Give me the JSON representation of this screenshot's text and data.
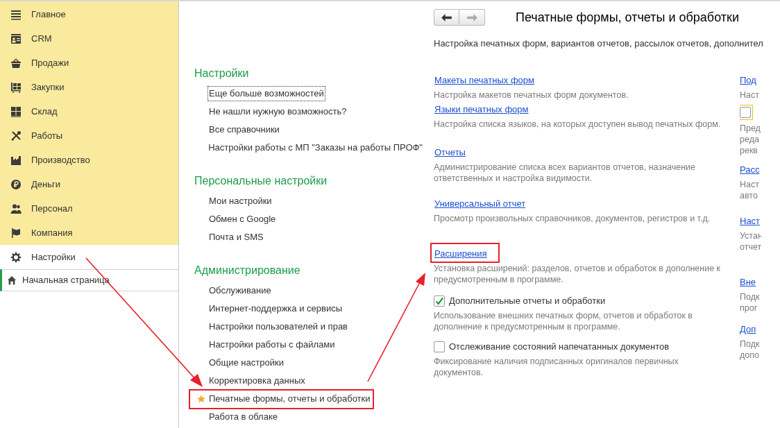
{
  "sidebar": {
    "sections": [
      {
        "label": "Главное",
        "selected": false
      },
      {
        "label": "CRM",
        "selected": false
      },
      {
        "label": "Продажи",
        "selected": false
      },
      {
        "label": "Закупки",
        "selected": false
      },
      {
        "label": "Склад",
        "selected": false
      },
      {
        "label": "Работы",
        "selected": false
      },
      {
        "label": "Производство",
        "selected": false
      },
      {
        "label": "Деньги",
        "selected": false
      },
      {
        "label": "Персонал",
        "selected": false
      },
      {
        "label": "Компания",
        "selected": false
      },
      {
        "label": "Настройки",
        "selected": true
      }
    ],
    "open_tabs": [
      {
        "label": "Начальная страница",
        "selected": true
      }
    ]
  },
  "nav_groups": [
    {
      "title": "Настройки",
      "items": [
        {
          "label": "Еще больше возможностей",
          "focused": true,
          "favorite": false,
          "annotated": false
        },
        {
          "label": "Не нашли нужную возможность?",
          "focused": false,
          "favorite": false,
          "annotated": false
        },
        {
          "label": "Все справочники",
          "focused": false,
          "favorite": false,
          "annotated": false
        },
        {
          "label": "Настройки работы с МП \"Заказы на работы ПРОФ\"",
          "focused": false,
          "favorite": false,
          "annotated": false
        }
      ]
    },
    {
      "title": "Персональные настройки",
      "items": [
        {
          "label": "Мои настройки",
          "focused": false,
          "favorite": false,
          "annotated": false
        },
        {
          "label": "Обмен с Google",
          "focused": false,
          "favorite": false,
          "annotated": false
        },
        {
          "label": "Почта и SMS",
          "focused": false,
          "favorite": false,
          "annotated": false
        }
      ]
    },
    {
      "title": "Администрирование",
      "items": [
        {
          "label": "Обслуживание",
          "focused": false,
          "favorite": false,
          "annotated": false
        },
        {
          "label": "Интернет-поддержка и сервисы",
          "focused": false,
          "favorite": false,
          "annotated": false
        },
        {
          "label": "Настройки пользователей и прав",
          "focused": false,
          "favorite": false,
          "annotated": false
        },
        {
          "label": "Настройки работы с файлами",
          "focused": false,
          "favorite": false,
          "annotated": false
        },
        {
          "label": "Общие настройки",
          "focused": false,
          "favorite": false,
          "annotated": false
        },
        {
          "label": "Корректировка данных",
          "focused": false,
          "favorite": false,
          "annotated": false
        },
        {
          "label": "Печатные формы, отчеты и обработки",
          "focused": false,
          "favorite": true,
          "annotated": true
        },
        {
          "label": "Работа в облаке",
          "focused": false,
          "favorite": false,
          "annotated": false
        }
      ]
    }
  ],
  "page": {
    "back_enabled": true,
    "forward_enabled": false,
    "title": "Печатные формы, отчеты и обработки",
    "description": "Настройка печатных форм, вариантов отчетов, рассылок отчетов, дополнител",
    "settings": [
      {
        "kind": "link",
        "label": "Макеты печатных форм",
        "description": "Настройка макетов печатных форм документов.",
        "annotated": false
      },
      {
        "kind": "link",
        "label": "Языки печатных форм",
        "description": "Настройка списка языков, на которых доступен вывод печатных форм.",
        "annotated": false
      },
      {
        "kind": "link",
        "label": "Отчеты",
        "description": "Администрирование списка всех вариантов отчетов, назначение ответственных и настройка видимости.",
        "annotated": false
      },
      {
        "kind": "link",
        "label": "Универсальный отчет",
        "description": "Просмотр произвольных справочников, документов, регистров и т.д.",
        "annotated": false
      },
      {
        "kind": "link",
        "label": "Расширения",
        "description": "Установка расширений: разделов, отчетов и обработок в дополнение к предусмотренным в программе.",
        "annotated": true
      },
      {
        "kind": "checkbox",
        "label": "Дополнительные отчеты и обработки",
        "checked": true,
        "description": "Использование внешних печатных форм, отчетов и обработок в дополнение к предусмотренным в программе."
      },
      {
        "kind": "checkbox",
        "label": "Отслеживание состояний напечатанных документов",
        "checked": false,
        "description": "Фиксирование наличия подписанных оригиналов первичных документов."
      }
    ],
    "side_settings": [
      {
        "kind": "link",
        "label": "Под",
        "description": [
          "Наст"
        ]
      },
      {
        "kind": "checkbox",
        "checked": false,
        "description": [
          "Пред",
          "реда",
          "рекв"
        ]
      },
      {
        "kind": "link",
        "label": "Расс",
        "description": [
          "Наст",
          "авто"
        ]
      },
      {
        "kind": "link",
        "label": "Наст",
        "description": [
          "Устан",
          "отчет"
        ]
      },
      {
        "kind": "link",
        "label": "Вне",
        "description": [
          "Подк",
          "прог"
        ]
      },
      {
        "kind": "link",
        "label": "Доп",
        "description": [
          "Подк",
          "допо"
        ]
      }
    ]
  }
}
